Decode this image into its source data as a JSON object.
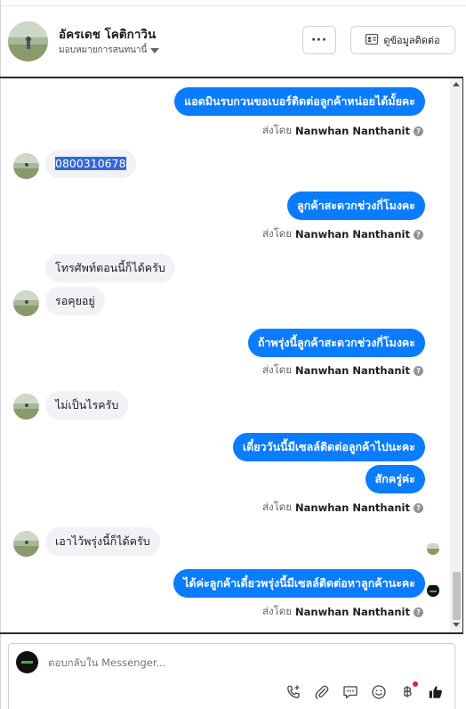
{
  "header": {
    "contact_name": "อัครเดช โคติกาวิน",
    "assign_label": "มอบหมายการสนทนานี้",
    "more_label": "···",
    "contact_info_label": "ดูข้อมูลติดต่อ"
  },
  "messages": {
    "out1": "แอดมินรบกวนขอเบอร์ติดต่อลูกค้าหน่อยได้มั้ยคะ",
    "in1": "0800310678",
    "out2": "ลูกค้าสะดวกช่วงกี่โมงคะ",
    "in2": "โทรศัพท์ตอนนี้ก็ได้ครับ",
    "in3": "รอคุยอยู่",
    "out3": "ถ้าพรุ่งนี้ลูกค้าสะดวกช่วงกี่โมงคะ",
    "in4": "ไม่เป็นไรครับ",
    "out4": "เดี๋ยววันนี้มีเซลล์ติดต่อลูกค้าไปนะคะ",
    "out5": "สักครู่ค่ะ",
    "in5": "เอาไว้พรุ่งนี้ก็ได้ครับ",
    "out6": "ได้ค่ะลูกค้าเดี๋ยวพรุ่งนี้มีเซลล์ติดต่อหาลูกค้านะคะ"
  },
  "sent_by": {
    "prefix": "ส่งโดย",
    "name": "Nanwhan Nanthanit",
    "info": "?"
  },
  "composer": {
    "placeholder": "ตอบกลับใน Messenger..."
  },
  "colors": {
    "outgoing_bubble": "#0a7cff",
    "incoming_bubble": "#f0f2f5",
    "like_icon": "#1c1e21",
    "notification_dot": "#e41e3f"
  },
  "icons": [
    "phone-add-icon",
    "paperclip-icon",
    "chat-bubble-icon",
    "smiley-icon",
    "baht-icon",
    "thumbs-up-icon"
  ]
}
